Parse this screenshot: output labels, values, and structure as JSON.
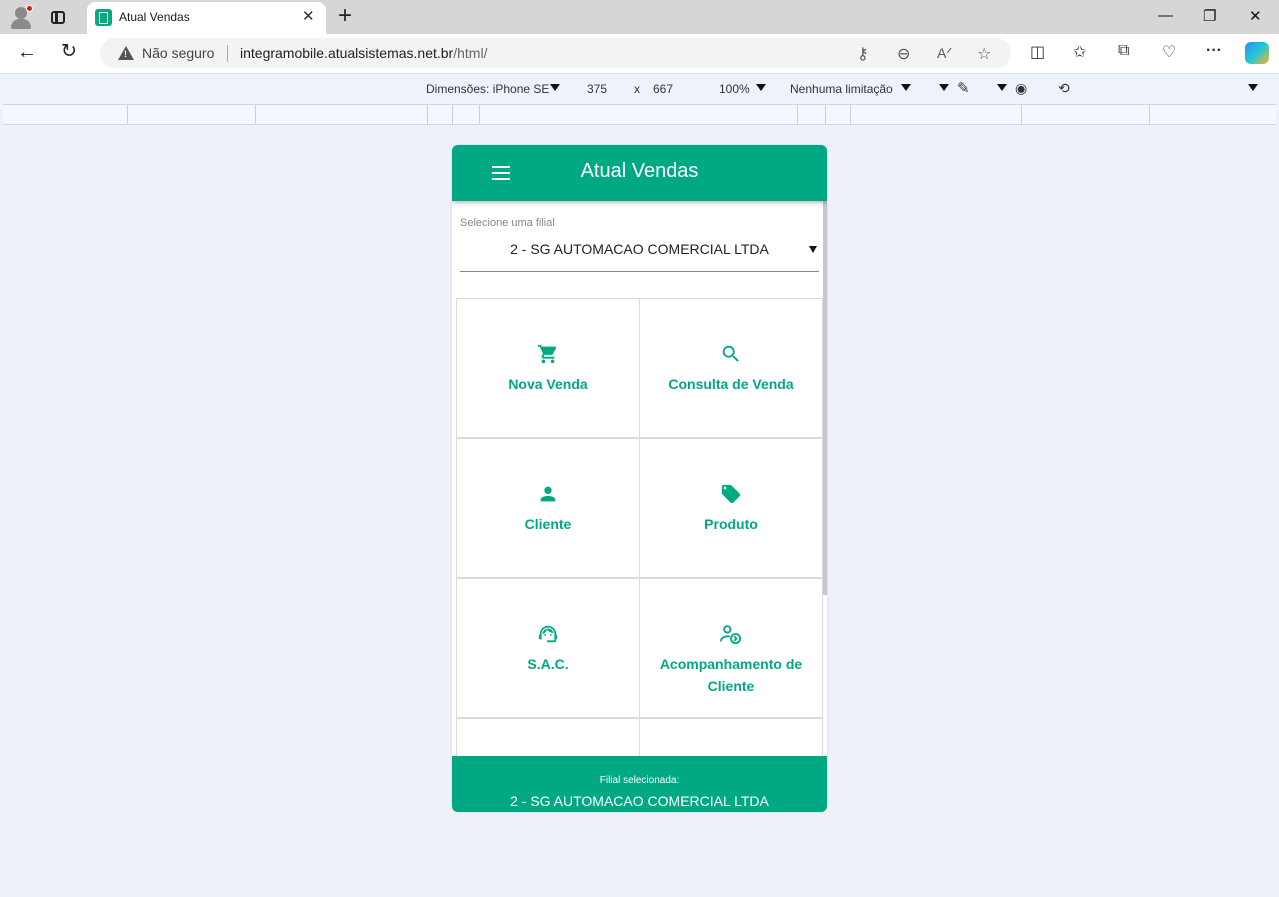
{
  "browser": {
    "tab_title": "Atual Vendas",
    "security_text": "Não seguro",
    "url_host": "integramobile.atualsistemas.net.br",
    "url_path": "/html/",
    "window_controls": {
      "minimize": "—",
      "restore": "❐",
      "close": "✕"
    }
  },
  "devtools": {
    "dimensions_label": "Dimensões: iPhone SE",
    "width": "375",
    "times": "x",
    "height": "667",
    "zoom": "100%",
    "throttling": "Nenhuma limitação"
  },
  "app": {
    "title": "Atual Vendas",
    "select_label": "Selecione uma filial",
    "select_value": "2 - SG AUTOMACAO COMERCIAL LTDA",
    "tiles": [
      {
        "label": "Nova Venda",
        "icon": "cart-icon"
      },
      {
        "label": "Consulta de Venda",
        "icon": "search-icon"
      },
      {
        "label": "Cliente",
        "icon": "person-icon"
      },
      {
        "label": "Produto",
        "icon": "tag-icon"
      },
      {
        "label": "S.A.C.",
        "icon": "support-agent-icon"
      },
      {
        "label": "Acompanhamento de Cliente",
        "icon": "person-track-icon"
      }
    ],
    "footer_label": "Filial selecionada:",
    "footer_value": "2 - SG AUTOMACAO COMERCIAL LTDA"
  },
  "colors": {
    "accent": "#00a884",
    "devtools_bg": "#edf1f9"
  }
}
